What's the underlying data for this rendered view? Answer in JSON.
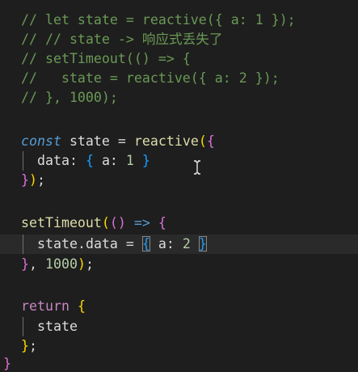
{
  "editor": {
    "lines": {
      "l1": "// let state = reactive({ a: 1 });",
      "l2": "// // state -> 响应式丢失了",
      "l3": "// setTimeout(() => {",
      "l4": "//   state = reactive({ a: 2 });",
      "l5": "// }, 1000);",
      "l7": {
        "kw": "const",
        "name": " state ",
        "eq": "=",
        "fn": " reactive",
        "paren": "(",
        "brace": "{"
      },
      "l8": {
        "key": "data",
        "colon": ": ",
        "open": "{",
        "inner": " a: ",
        "num": "1",
        "close": " }"
      },
      "l9": {
        "brace": "}",
        "paren": ")",
        "semi": ";"
      },
      "l11": {
        "fn": "setTimeout",
        "p1": "(",
        "p2": "()",
        "arrow": " => ",
        "brace": "{"
      },
      "l12": {
        "obj": "state",
        "dot": ".",
        "prop": "data",
        "eq": " = ",
        "open": "{",
        "inner": " a: ",
        "num": "2",
        "space": " ",
        "close": "}"
      },
      "l13": {
        "brace": "}",
        "comma": ", ",
        "num": "1000",
        "paren": ")",
        "semi": ";"
      },
      "l15": {
        "kw": "return",
        "space": " ",
        "brace": "{"
      },
      "l16": "state",
      "l17": {
        "brace": "}",
        "semi": ";"
      },
      "l18": "}"
    },
    "cursor_icon": "text-cursor-icon"
  }
}
